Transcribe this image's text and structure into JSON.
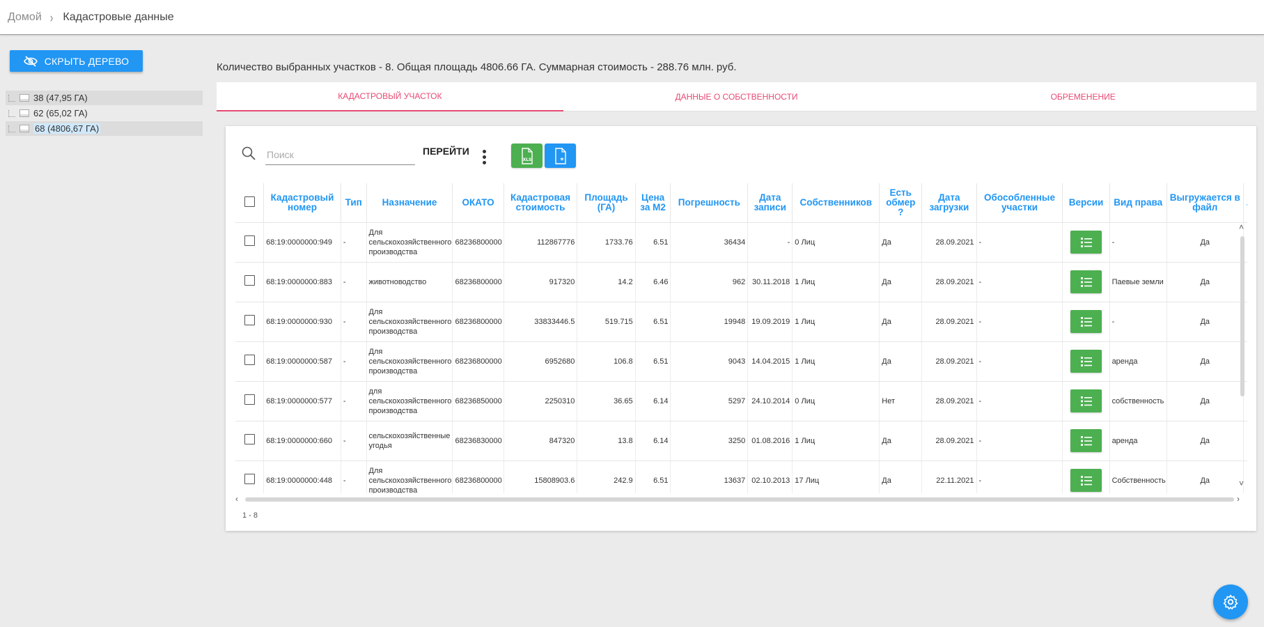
{
  "breadcrumb": {
    "home": "Домой",
    "current": "Кадастровые данные"
  },
  "left_panel": {
    "hide_tree_label": "Скрыть дерево",
    "tree": [
      {
        "label": "38 (47,95 ГА)"
      },
      {
        "label": "62 (65,02 ГА)"
      },
      {
        "label": "68 (4806,67 ГА)"
      }
    ]
  },
  "summary": "Количество выбранных участков - 8. Общая площадь 4806.66 ГА. Суммарная стоимость - 288.76 млн. руб.",
  "tabs": [
    {
      "label": "Кадастровый участок",
      "active": true
    },
    {
      "label": "Данные о собственности",
      "active": false
    },
    {
      "label": "Обременение",
      "active": false
    }
  ],
  "toolbar": {
    "search_placeholder": "Поиск",
    "go_label": "ПЕРЕЙТИ",
    "xls_icon": "xls-file-icon",
    "doc_icon": "file-asterisk-icon"
  },
  "table": {
    "columns": [
      "Кадастровый номер",
      "Тип",
      "Назначение",
      "ОКАТО",
      "Кадастровая стоимость",
      "Площадь (ГА)",
      "Цена за М2",
      "Погрешность",
      "Дата записи",
      "Собственников",
      "Есть обмер ?",
      "Дата загрузки",
      "Обособленные участки",
      "Версии",
      "Вид права",
      "Выгружается в файл",
      "."
    ],
    "rows": [
      {
        "cadastral": "68:19:0000000:949",
        "type": "-",
        "purpose": "Для сельскохозяйственного производства",
        "okato": "68236800000",
        "cost": "112867776",
        "area": "1733.76",
        "price": "6.51",
        "error": "36434",
        "record_date": "-",
        "owners": "0 Лиц",
        "measured": "Да",
        "load_date": "28.09.2021",
        "separate": "-",
        "right": "-",
        "export": "Да"
      },
      {
        "cadastral": "68:19:0000000:883",
        "type": "-",
        "purpose": "животноводство",
        "okato": "68236800000",
        "cost": "917320",
        "area": "14.2",
        "price": "6.46",
        "error": "962",
        "record_date": "30.11.2018",
        "owners": "1 Лиц",
        "measured": "Да",
        "load_date": "28.09.2021",
        "separate": "-",
        "right": "Паевые земли",
        "export": "Да"
      },
      {
        "cadastral": "68:19:0000000:930",
        "type": "-",
        "purpose": "Для сельскохозяйственного производства",
        "okato": "68236800000",
        "cost": "33833446.5",
        "area": "519.715",
        "price": "6.51",
        "error": "19948",
        "record_date": "19.09.2019",
        "owners": "1 Лиц",
        "measured": "Да",
        "load_date": "28.09.2021",
        "separate": "-",
        "right": "-",
        "export": "Да"
      },
      {
        "cadastral": "68:19:0000000:587",
        "type": "-",
        "purpose": "Для сельскохозяйственного производства",
        "okato": "68236800000",
        "cost": "6952680",
        "area": "106.8",
        "price": "6.51",
        "error": "9043",
        "record_date": "14.04.2015",
        "owners": "1 Лиц",
        "measured": "Да",
        "load_date": "28.09.2021",
        "separate": "-",
        "right": "аренда",
        "export": "Да"
      },
      {
        "cadastral": "68:19:0000000:577",
        "type": "-",
        "purpose": "для сельскохозяйственного производства",
        "okato": "68236850000",
        "cost": "2250310",
        "area": "36.65",
        "price": "6.14",
        "error": "5297",
        "record_date": "24.10.2014",
        "owners": "0 Лиц",
        "measured": "Нет",
        "load_date": "28.09.2021",
        "separate": "-",
        "right": "собственность",
        "export": "Да"
      },
      {
        "cadastral": "68:19:0000000:660",
        "type": "-",
        "purpose": "сельскохозяйственные угодья",
        "okato": "68236830000",
        "cost": "847320",
        "area": "13.8",
        "price": "6.14",
        "error": "3250",
        "record_date": "01.08.2016",
        "owners": "1 Лиц",
        "measured": "Да",
        "load_date": "28.09.2021",
        "separate": "-",
        "right": "аренда",
        "export": "Да"
      },
      {
        "cadastral": "68:19:0000000:448",
        "type": "-",
        "purpose": "Для сельскохозяйственного производства",
        "okato": "68236800000",
        "cost": "15808903.6",
        "area": "242.9",
        "price": "6.51",
        "error": "13637",
        "record_date": "02.10.2013",
        "owners": "17 Лиц",
        "measured": "Да",
        "load_date": "22.11.2021",
        "separate": "-",
        "right": "Собственность",
        "export": "Да"
      }
    ]
  },
  "pager": "1 - 8",
  "fab_icon": "gear-icon",
  "colors": {
    "primary": "#2196f3",
    "green": "#4caf50",
    "tab_accent": "#e84a73"
  }
}
